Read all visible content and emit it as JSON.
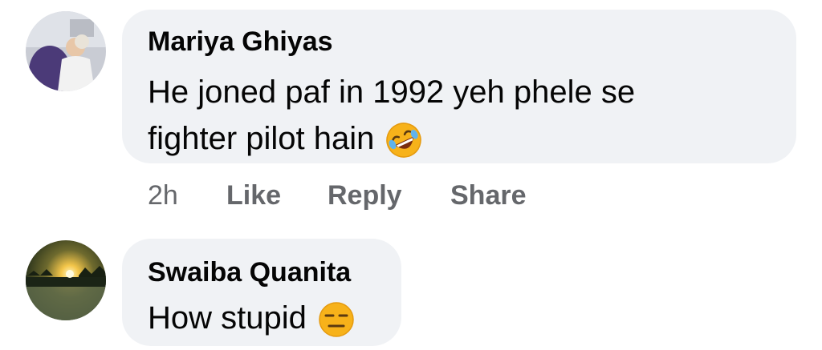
{
  "comments": [
    {
      "author": "Mariya Ghiyas",
      "line1": "He joned paf in 1992 yeh phele se",
      "line2": "fighter pilot hain",
      "emoji_icon": "rolling-on-floor-laughing-emoji-icon",
      "time": "2h",
      "like_label": "Like",
      "reply_label": "Reply",
      "share_label": "Share"
    },
    {
      "author": "Swaiba Quanita",
      "line1": "How stupid",
      "emoji_icon": "expressionless-face-emoji-icon"
    }
  ],
  "colors": {
    "bubble": "#f0f2f5",
    "text": "#050505",
    "secondary": "#65676b"
  }
}
